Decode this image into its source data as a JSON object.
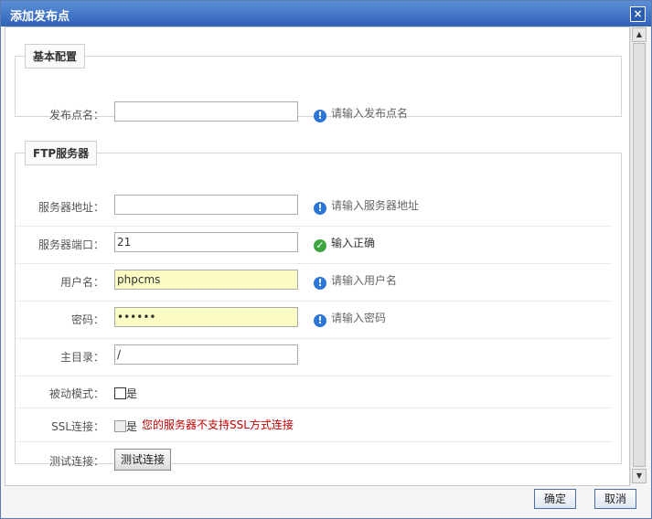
{
  "dialog": {
    "title": "添加发布点",
    "close_icon": "×"
  },
  "section_basic": {
    "legend": "基本配置",
    "name_label": "发布点名：",
    "name_value": "",
    "name_hint": "请输入发布点名"
  },
  "section_ftp": {
    "legend": "FTP服务器",
    "host_label": "服务器地址：",
    "host_value": "",
    "host_hint": "请输入服务器地址",
    "port_label": "服务器端口：",
    "port_value": "21",
    "port_hint": "输入正确",
    "user_label": "用户名：",
    "user_value": "phpcms",
    "user_hint": "请输入用户名",
    "pwd_label": "密码：",
    "pwd_value": "••••••",
    "pwd_hint": "请输入密码",
    "dir_label": "主目录：",
    "dir_value": "/",
    "passive_label": "被动模式：",
    "passive_option": "是",
    "ssl_label": "SSL连接：",
    "ssl_option": "是",
    "ssl_error": "您的服务器不支持SSL方式连接",
    "test_label": "测试连接：",
    "test_button": "测试连接"
  },
  "icons": {
    "info": "!",
    "ok": "✓"
  },
  "footer": {
    "ok": "确定",
    "cancel": "取消"
  }
}
